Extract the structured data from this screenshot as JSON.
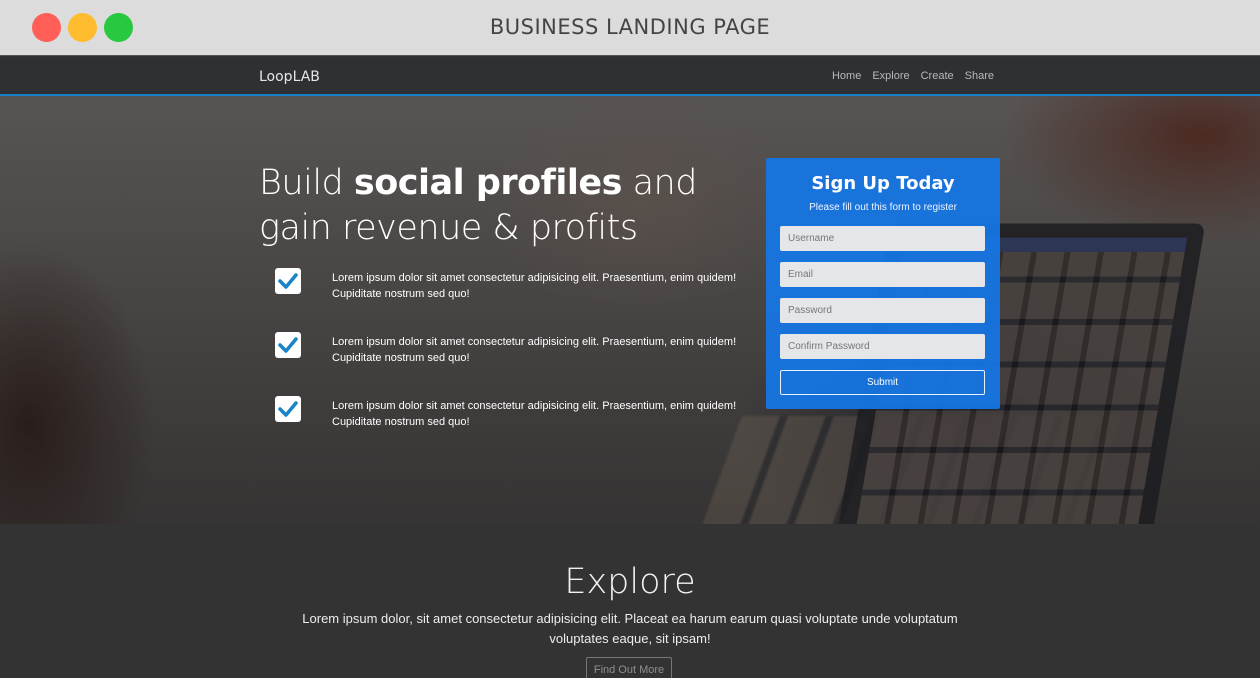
{
  "window": {
    "title": "BUSINESS LANDING PAGE"
  },
  "colors": {
    "accent": "#1476e6",
    "nav_border": "#1a7fc4",
    "close": "#ff5f57",
    "minimize": "#febc2e",
    "maximize": "#28c840"
  },
  "navbar": {
    "brand": "LoopLAB",
    "links": [
      {
        "label": "Home"
      },
      {
        "label": "Explore"
      },
      {
        "label": "Create"
      },
      {
        "label": "Share"
      }
    ]
  },
  "hero": {
    "headline_part1": "Build ",
    "headline_bold": "social profiles",
    "headline_part2": " and gain revenue & profits",
    "features": [
      {
        "icon": "check-icon",
        "text": "Lorem ipsum dolor sit amet consectetur adipisicing elit. Praesentium, enim quidem! Cupiditate nostrum sed quo!"
      },
      {
        "icon": "check-icon",
        "text": "Lorem ipsum dolor sit amet consectetur adipisicing elit. Praesentium, enim quidem! Cupiditate nostrum sed quo!"
      },
      {
        "icon": "check-icon",
        "text": "Lorem ipsum dolor sit amet consectetur adipisicing elit. Praesentium, enim quidem! Cupiditate nostrum sed quo!"
      }
    ]
  },
  "signup": {
    "title": "Sign Up Today",
    "subtitle": "Please fill out this form to register",
    "username_placeholder": "Username",
    "email_placeholder": "Email",
    "password_placeholder": "Password",
    "confirm_placeholder": "Confirm Password",
    "submit_label": "Submit"
  },
  "explore": {
    "title": "Explore",
    "text": "Lorem ipsum dolor, sit amet consectetur adipisicing elit. Placeat ea harum earum quasi voluptate unde voluptatum voluptates eaque, sit ipsam!",
    "button_label": "Find Out More"
  }
}
